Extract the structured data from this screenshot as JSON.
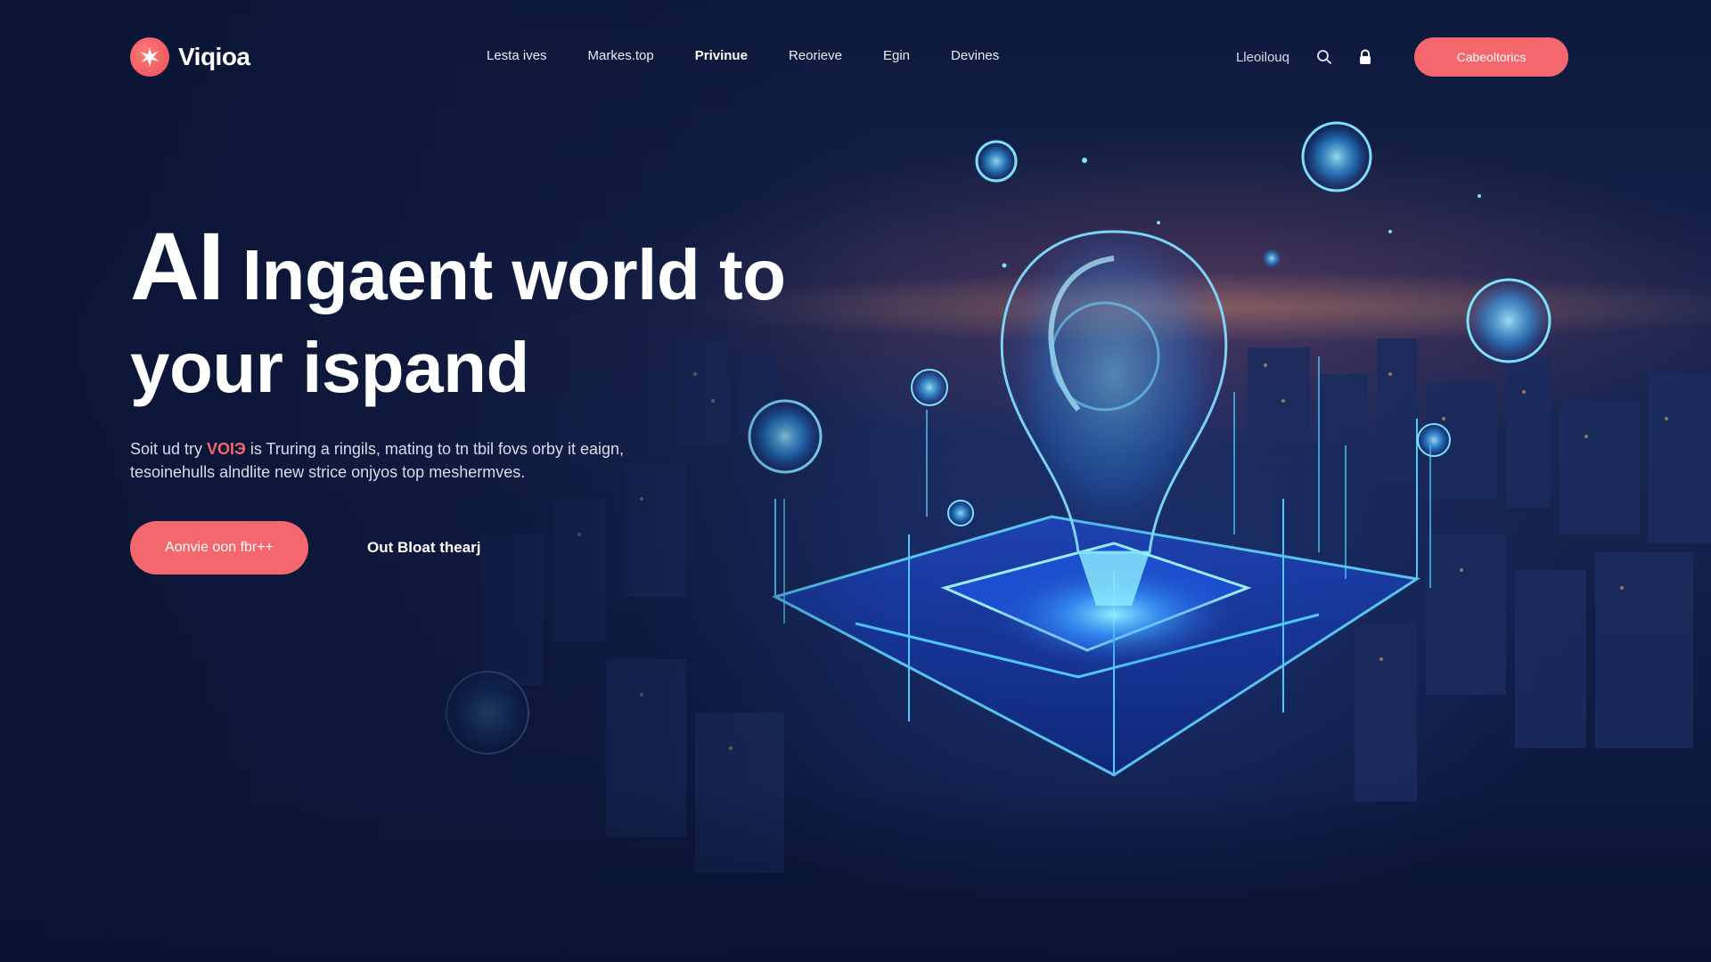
{
  "brand": {
    "name": "Viqioa",
    "accent_color": "#f4676c",
    "logo_icon": "starburst-logo-icon"
  },
  "nav": {
    "links": [
      {
        "label": "Lesta ives",
        "active": false
      },
      {
        "label": "Markes.top",
        "active": false
      },
      {
        "label": "Privinue",
        "active": true
      },
      {
        "label": "Reorieve",
        "active": false
      },
      {
        "label": "Egin",
        "active": false
      },
      {
        "label": "Devines",
        "active": false
      }
    ],
    "text_link": "Lleoilouq",
    "search_icon": "search-icon",
    "account_icon": "lock-icon",
    "cta_label": "Cabeoltorics"
  },
  "hero": {
    "title_big": "AI",
    "title_rest": " Ingaent world to",
    "title_line2": "your ispand",
    "subtitle_pre": "Soit ud try ",
    "subtitle_accent": "VOIЭ",
    "subtitle_post": " is Truring a ringils, mating to tn tbil fovs orby it eaign, tesoinehulls alndlite new strice onjyos top meshermves.",
    "primary_cta": "Aonvie oon fbr++",
    "secondary_cta": "Out Bloat thearj"
  },
  "colors": {
    "background": "#0b1533",
    "glow": "#39b8ff"
  }
}
